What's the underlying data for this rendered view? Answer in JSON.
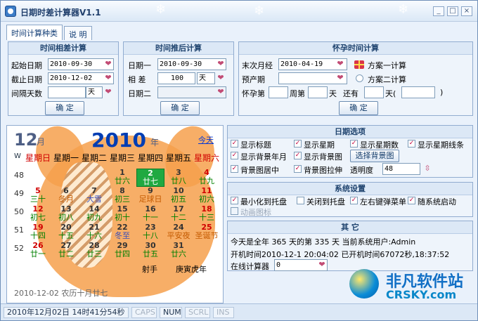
{
  "window": {
    "title": "日期时差计算器V1.1",
    "minimize_label": "_",
    "maximize_label": "□",
    "close_label": "×"
  },
  "tabs": [
    {
      "label": "时间计算种类"
    },
    {
      "label": "说 明"
    }
  ],
  "diff": {
    "title": "时间相差计算",
    "start_label": "起始日期",
    "start_value": "2010-09-30",
    "end_label": "截止日期",
    "end_value": "2010-12-02",
    "interval_label": "间隔天数",
    "interval_value": "",
    "unit": "天",
    "button": "确 定"
  },
  "after": {
    "title": "时间推后计算",
    "date1_label": "日期一",
    "date1_value": "2010-09-30",
    "diff_label": "相 差",
    "diff_value": "100",
    "unit": "天",
    "date2_label": "日期二",
    "date2_value": "",
    "button": "确 定"
  },
  "pregnancy": {
    "title": "怀孕时间计算",
    "last_label": "末次月经",
    "last_value": "2010-04-19",
    "plan1": "方案一计算",
    "due_label": "预产期",
    "due_value": "",
    "plan2": "方案二计算",
    "pregnant_label": "怀孕第",
    "week_label": "周第",
    "day_label": "天",
    "remain_label": "还有",
    "remain_day_label": "天(",
    "paren_close": ")",
    "button": "确 定"
  },
  "calendar": {
    "month": "12",
    "month_suffix": "月",
    "year": "2010",
    "year_suffix": "年",
    "today": "今天",
    "week_header": "W",
    "weekdays": [
      "星期日",
      "星期一",
      "星期二",
      "星期三",
      "星期四",
      "星期五",
      "星期六"
    ],
    "week_numbers": [
      "48",
      "49",
      "50",
      "51",
      "52"
    ],
    "rows": [
      [
        {
          "n": "",
          "l": ""
        },
        {
          "n": "",
          "l": ""
        },
        {
          "n": "",
          "l": ""
        },
        {
          "n": "1",
          "l": "廿六"
        },
        {
          "n": "2",
          "l": "廿七"
        },
        {
          "n": "3",
          "l": "廿八"
        },
        {
          "n": "4",
          "l": "廿九"
        }
      ],
      [
        {
          "n": "5",
          "l": "三十"
        },
        {
          "n": "6",
          "l": "冬月"
        },
        {
          "n": "7",
          "l": "大雪"
        },
        {
          "n": "8",
          "l": "初三"
        },
        {
          "n": "9",
          "l": "足球日"
        },
        {
          "n": "10",
          "l": "初五"
        },
        {
          "n": "11",
          "l": "初六"
        }
      ],
      [
        {
          "n": "12",
          "l": "初七"
        },
        {
          "n": "13",
          "l": "初八"
        },
        {
          "n": "14",
          "l": "初九"
        },
        {
          "n": "15",
          "l": "初十"
        },
        {
          "n": "16",
          "l": "十一"
        },
        {
          "n": "17",
          "l": "十二"
        },
        {
          "n": "18",
          "l": "十三"
        }
      ],
      [
        {
          "n": "19",
          "l": "十四"
        },
        {
          "n": "20",
          "l": "十五"
        },
        {
          "n": "21",
          "l": "十六"
        },
        {
          "n": "22",
          "l": "冬至"
        },
        {
          "n": "23",
          "l": "十八"
        },
        {
          "n": "24",
          "l": "平安夜"
        },
        {
          "n": "25",
          "l": "圣诞节"
        }
      ],
      [
        {
          "n": "26",
          "l": "廿一"
        },
        {
          "n": "27",
          "l": "廿二"
        },
        {
          "n": "28",
          "l": "廿三"
        },
        {
          "n": "29",
          "l": "廿四"
        },
        {
          "n": "30",
          "l": "廿五"
        },
        {
          "n": "31",
          "l": "廿六"
        },
        {
          "n": "",
          "l": ""
        }
      ]
    ],
    "sign": "射手",
    "ganzhi": "庚寅虎年",
    "bottom": "2010-12-02  农历十月廿七"
  },
  "date_options": {
    "title": "日期选项",
    "items": [
      "显示标题",
      "显示星期",
      "显示星期数",
      "显示星期线条",
      "显示背景年月",
      "显示背景图",
      "选择背景图",
      "背景图居中",
      "背景图拉伸",
      "透明度"
    ],
    "opacity": "48"
  },
  "system_settings": {
    "title": "系统设置",
    "items": [
      "最小化到托盘",
      "关闭到托盘",
      "左右键弹菜单",
      "随系统启动",
      "动画图标"
    ]
  },
  "other": {
    "title": "其 它",
    "line1": "今天是全年 365 天的第 335 天   当前系统用户:Admin",
    "line2": "开机时间2010-12-1 20:04:02   已开机时间67072秒,18:37:52",
    "online_label": "在线计算器",
    "online_value": "0"
  },
  "status": {
    "datetime": "2010年12月02日 14时41分54秒",
    "caps": "CAPS",
    "num": "NUM",
    "scrl": "SCRL",
    "ins": "INS"
  },
  "logo": {
    "cn": "非凡软件站",
    "en": "CRSKY.com"
  }
}
